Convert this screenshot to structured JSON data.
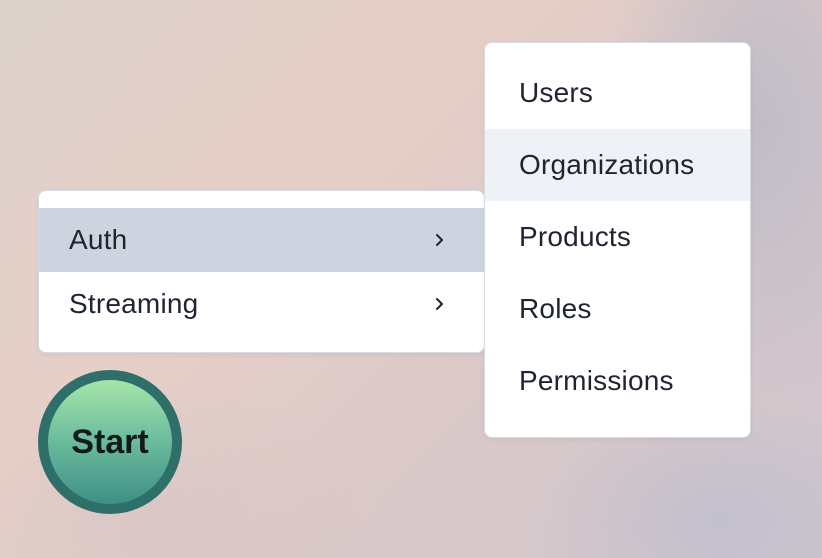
{
  "main_menu": {
    "items": [
      {
        "label": "Auth",
        "has_submenu": true,
        "active": true
      },
      {
        "label": "Streaming",
        "has_submenu": true,
        "active": false
      }
    ]
  },
  "submenu": {
    "parent": "Auth",
    "items": [
      {
        "label": "Users",
        "hovered": false
      },
      {
        "label": "Organizations",
        "hovered": true
      },
      {
        "label": "Products",
        "hovered": false
      },
      {
        "label": "Roles",
        "hovered": false
      },
      {
        "label": "Permissions",
        "hovered": false
      }
    ]
  },
  "start_button": {
    "label": "Start"
  },
  "icons": {
    "submenu_indicator": "chevron-right-icon"
  },
  "colors": {
    "active_item_bg": "#cdd4df",
    "hover_item_bg": "#eef1f5",
    "start_ring": "#2f6f6a",
    "start_gradient_top": "#a6e5a8",
    "start_gradient_bottom": "#3e8f85"
  }
}
